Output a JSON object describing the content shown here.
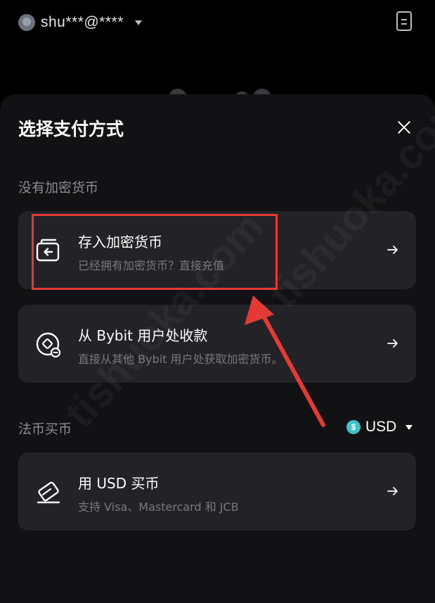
{
  "header": {
    "account_name": "shu***@****"
  },
  "sheet": {
    "title": "选择支付方式",
    "section_no_crypto": "没有加密货币",
    "section_fiat": "法币买币",
    "currency": {
      "symbol": "$",
      "code": "USD"
    },
    "options": [
      {
        "title": "存入加密货币",
        "subtitle": "已经拥有加密货币？直接充值"
      },
      {
        "title": "从 Bybit 用户处收款",
        "subtitle": "直接从其他 Bybit 用户处获取加密货币。"
      },
      {
        "title": "用 USD 买币",
        "subtitle": "支持 Visa、Mastercard 和 JCB"
      }
    ]
  },
  "watermark": "tishuoka.com",
  "colors": {
    "background": "#000000",
    "sheet": "#121214",
    "card": "#232327",
    "annotation": "#e53935",
    "coin": "#3fc3c6"
  }
}
